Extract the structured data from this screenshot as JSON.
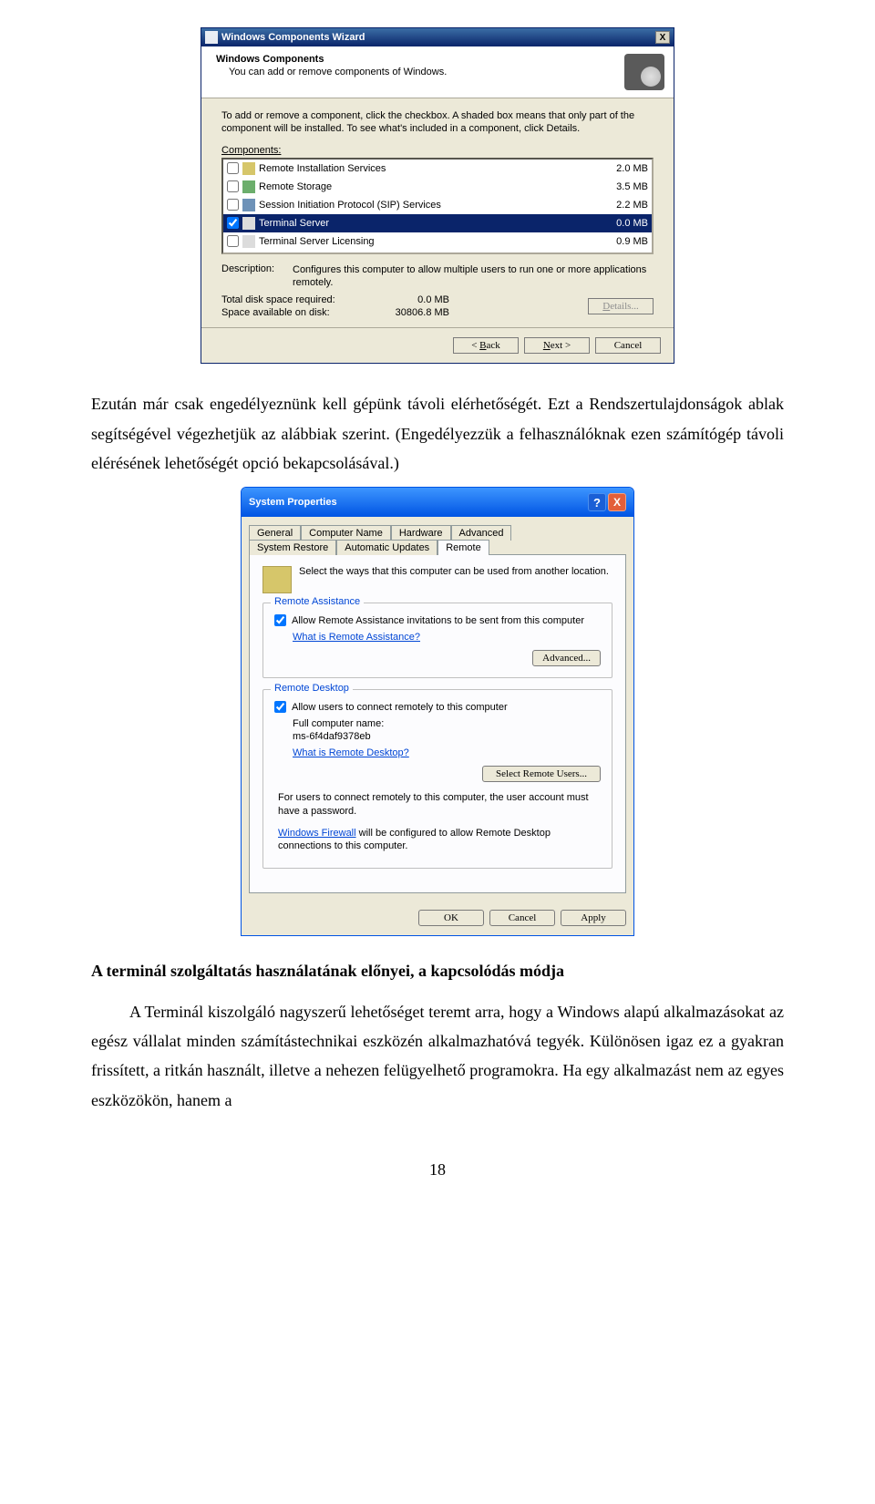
{
  "wizard": {
    "title": "Windows Components Wizard",
    "close_x": "X",
    "header_title": "Windows Components",
    "header_sub": "You can add or remove components of Windows.",
    "instructions": "To add or remove a component, click the checkbox. A shaded box means that only part of the component will be installed. To see what's included in a component, click Details.",
    "components_label_pre": "C",
    "components_label_post": "omponents:",
    "items": [
      {
        "checked": false,
        "name": "Remote Installation Services",
        "size": "2.0 MB"
      },
      {
        "checked": false,
        "name": "Remote Storage",
        "size": "3.5 MB"
      },
      {
        "checked": false,
        "name": "Session Initiation Protocol (SIP) Services",
        "size": "2.2 MB"
      },
      {
        "checked": true,
        "name": "Terminal Server",
        "size": "0.0 MB"
      },
      {
        "checked": false,
        "name": "Terminal Server Licensing",
        "size": "0.9 MB"
      }
    ],
    "desc_label": "Description:",
    "desc_value": "Configures this computer to allow multiple users to run one or more applications remotely.",
    "disk_req_label": "Total disk space required:",
    "disk_req_value": "0.0 MB",
    "disk_avail_label": "Space available on disk:",
    "disk_avail_value": "30806.8 MB",
    "details_btn_pre": "D",
    "details_btn_post": "etails...",
    "back_pre": "< ",
    "back_u": "B",
    "back_post": "ack",
    "next_u": "N",
    "next_post": "ext >",
    "cancel": "Cancel"
  },
  "para1": "Ezután már csak engedélyeznünk kell gépünk távoli elérhetőségét. Ezt a Rendszertulajdonságok ablak segítségével végezhetjük az alábbiak szerint. (Engedélyezzük a felhasználóknak ezen számítógép távoli elérésének lehetőségét opció bekapcsolásával.)",
  "sysprops": {
    "title": "System Properties",
    "help_q": "?",
    "close_x": "X",
    "tabs_row1": [
      "General",
      "Computer Name",
      "Hardware",
      "Advanced"
    ],
    "tabs_row2": [
      "System Restore",
      "Automatic Updates",
      "Remote"
    ],
    "lead": "Select the ways that this computer can be used from another location.",
    "ra_group": "Remote Assistance",
    "ra_check": "Allow Remote Assistance invitations to be sent from this computer",
    "ra_link": "What is Remote Assistance?",
    "ra_adv": "Advanced...",
    "rd_group": "Remote Desktop",
    "rd_check": "Allow users to connect remotely to this computer",
    "rd_fcn_label": "Full computer name:",
    "rd_fcn_value": "ms-6f4daf9378eb",
    "rd_link": "What is Remote Desktop?",
    "rd_select": "Select Remote Users...",
    "rd_note1": "For users to connect remotely to this computer, the user account must have a password.",
    "rd_note2": "Windows Firewall",
    "rd_note2b": " will be configured to allow Remote Desktop connections to this computer.",
    "ok": "OK",
    "cancel": "Cancel",
    "apply": "Apply"
  },
  "section_heading": "A terminál szolgáltatás használatának előnyei, a kapcsolódás módja",
  "para2": "A Terminál kiszolgáló nagyszerű lehetőséget teremt arra, hogy a Windows alapú alkalmazásokat az egész vállalat minden számítástechnikai eszközén alkalmazhatóvá tegyék. Különösen igaz ez a gyakran frissített, a ritkán használt, illetve a nehezen felügyelhető programokra. Ha egy alkalmazást nem az egyes eszközökön, hanem a",
  "page_number": "18"
}
